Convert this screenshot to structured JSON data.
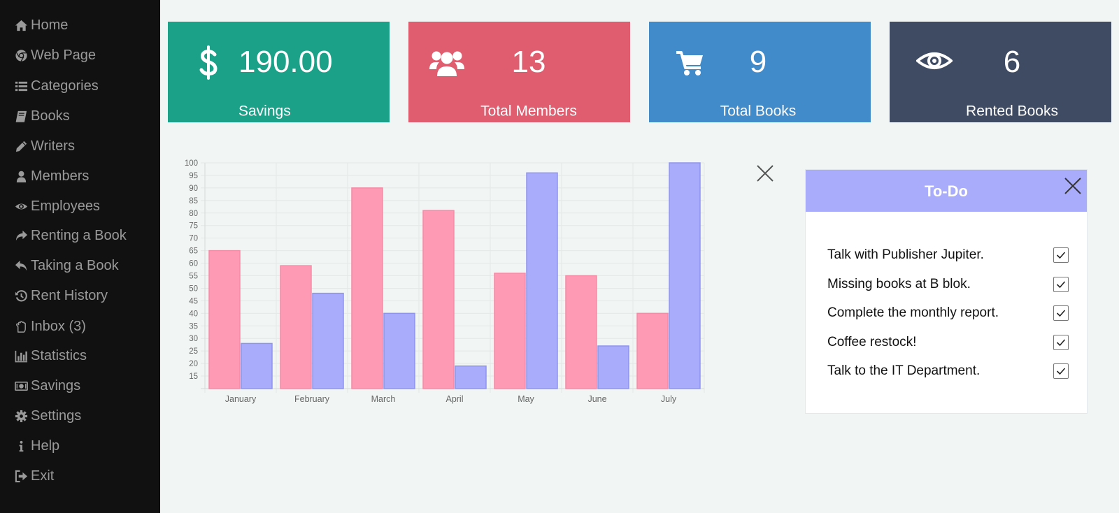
{
  "sidebar": {
    "items": [
      {
        "label": "Home",
        "icon": "home-icon"
      },
      {
        "label": "Web Page",
        "icon": "chrome-icon"
      },
      {
        "label": "Categories",
        "icon": "list-icon"
      },
      {
        "label": "Books",
        "icon": "book-icon"
      },
      {
        "label": "Writers",
        "icon": "pencil-icon"
      },
      {
        "label": "Members",
        "icon": "user-icon"
      },
      {
        "label": "Employees",
        "icon": "eye-icon"
      },
      {
        "label": "Renting a Book",
        "icon": "share-icon"
      },
      {
        "label": "Taking a Book",
        "icon": "reply-icon"
      },
      {
        "label": "Rent History",
        "icon": "history-icon"
      },
      {
        "label": "Inbox (3)",
        "icon": "hand-icon"
      },
      {
        "label": "Statistics",
        "icon": "bar-chart-icon"
      },
      {
        "label": "Savings",
        "icon": "money-icon"
      },
      {
        "label": "Settings",
        "icon": "gear-icon"
      },
      {
        "label": "Help",
        "icon": "info-icon"
      },
      {
        "label": "Exit",
        "icon": "sign-out-icon"
      }
    ]
  },
  "cards": [
    {
      "value": "190.00",
      "label": "Savings",
      "color": "#1aa188",
      "icon": "dollar-icon"
    },
    {
      "value": "13",
      "label": "Total Members",
      "color": "#e05d6f",
      "icon": "users-icon"
    },
    {
      "value": "9",
      "label": "Total Books",
      "color": "#428bca",
      "icon": "cart-icon"
    },
    {
      "value": "6",
      "label": "Rented Books",
      "color": "#3e4b62",
      "icon": "eye-icon"
    }
  ],
  "chart_data": {
    "type": "bar",
    "categories": [
      "January",
      "February",
      "March",
      "April",
      "May",
      "June",
      "July"
    ],
    "series": [
      {
        "values": [
          65,
          59,
          90,
          81,
          56,
          55,
          40
        ],
        "color": "#ff9ab4"
      },
      {
        "values": [
          28,
          48,
          40,
          19,
          96,
          27,
          100
        ],
        "color": "#a9acfa"
      }
    ],
    "ylim": [
      10,
      100
    ],
    "yticks": [
      15,
      20,
      25,
      30,
      35,
      40,
      45,
      50,
      55,
      60,
      65,
      70,
      75,
      80,
      85,
      90,
      95,
      100
    ],
    "grid": true
  },
  "todo": {
    "title": "To-Do",
    "items": [
      {
        "text": "Talk with Publisher Jupiter.",
        "checked": true
      },
      {
        "text": "Missing books at B blok.",
        "checked": true
      },
      {
        "text": "Complete the monthly report.",
        "checked": true
      },
      {
        "text": "Coffee restock!",
        "checked": true
      },
      {
        "text": "Talk to the IT Department.",
        "checked": true
      }
    ]
  }
}
